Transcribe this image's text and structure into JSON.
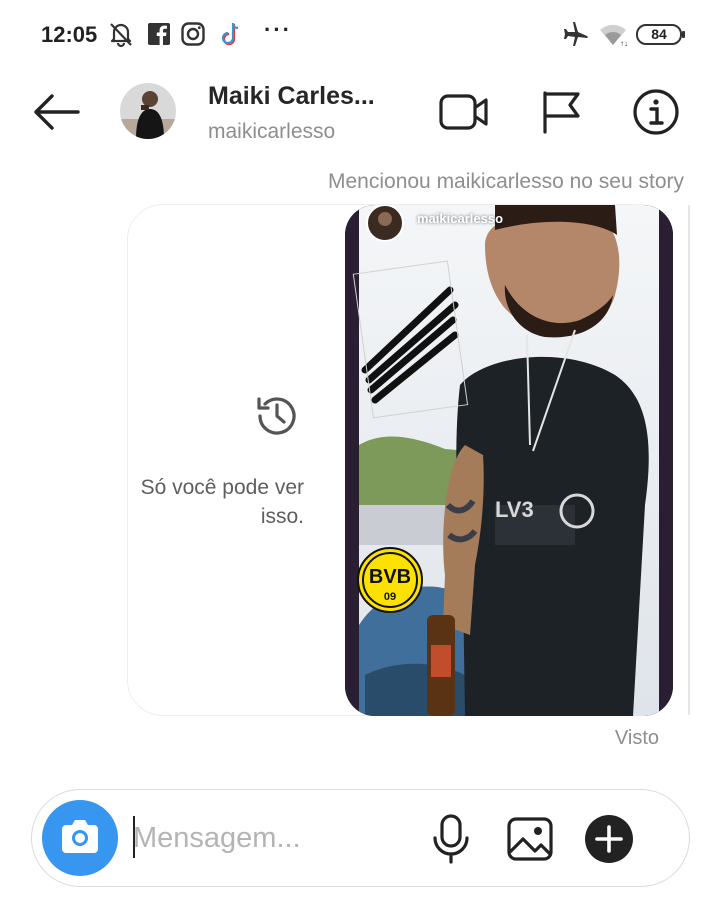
{
  "status_bar": {
    "time": "12:05",
    "left_icons": [
      "bell-muted-icon",
      "facebook-icon",
      "instagram-icon",
      "tiktok-icon"
    ],
    "more": "···",
    "right_icons": [
      "airplane-mode-icon",
      "wifi-icon"
    ],
    "battery": "84"
  },
  "header": {
    "display_name": "Maiki Carles...",
    "username": "maikicarlesso",
    "icons": [
      "back-arrow-icon",
      "video-call-icon",
      "flag-icon",
      "info-icon"
    ]
  },
  "thread": {
    "mention_note": "Mencionou maikicarlesso no seu story",
    "private_notice": "Só você pode ver isso.",
    "story_author": "maikicarlesso",
    "story_badge": "BVB",
    "story_badge_year": "09",
    "seen_label": "Visto"
  },
  "composer": {
    "placeholder": "Mensagem...",
    "value": "",
    "icons": [
      "camera-icon",
      "microphone-icon",
      "gallery-icon",
      "plus-circle-icon"
    ]
  },
  "colors": {
    "accent_blue": "#3797f0",
    "muted_text": "#8e8e8e",
    "story_frame": "#2a1e33",
    "badge_yellow": "#fde100"
  }
}
